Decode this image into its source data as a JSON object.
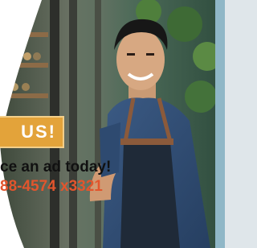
{
  "ad": {
    "badge_text": "US!",
    "tagline": "ce an ad today!",
    "phone": "88-4574 x3321"
  },
  "colors": {
    "badge": "#e3a33a",
    "phone_text": "#e2552d",
    "accent_strip": "#8fb7c7",
    "page_bg": "#dfe6ea"
  }
}
